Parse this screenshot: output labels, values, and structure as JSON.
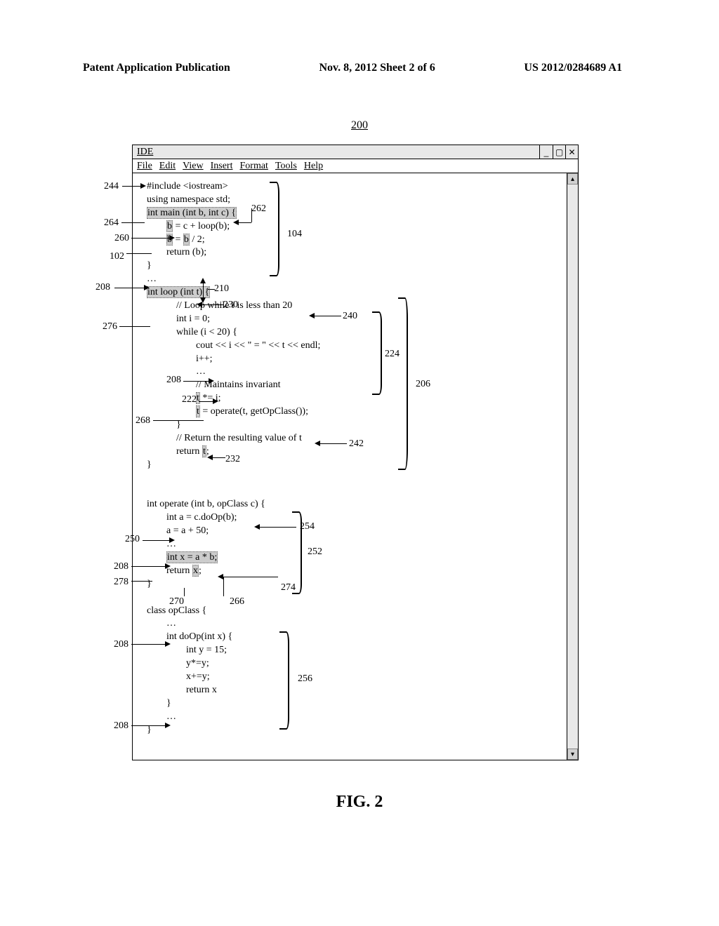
{
  "header": {
    "left": "Patent Application Publication",
    "center": "Nov. 8, 2012  Sheet 2 of 6",
    "right": "US 2012/0284689 A1"
  },
  "figure_number": "200",
  "window": {
    "title": "IDE",
    "menu": [
      "File",
      "Edit",
      "View",
      "Insert",
      "Format",
      "Tools",
      "Help"
    ]
  },
  "code": {
    "l1": "#include <iostream>",
    "l2": "using namespace std;",
    "blank1": "",
    "l3": "int main (int b, int c) {",
    "l4": "        b = c + loop(b);",
    "l5": "        b = b / 2;",
    "l6": "        return (b);",
    "l7": "}",
    "l8": "…",
    "l9": "int loop (int t) {",
    "l10": "            // Loop while i is less than 20",
    "l11": "            int i = 0;",
    "l12": "            while (i < 20) {",
    "l13": "                    cout << i << \" = \" << t << endl;",
    "l14": "                    i++;",
    "l15": "                    …",
    "l16": "                    // Maintains invariant",
    "l17": "                    t *= i;",
    "l18": "                    t = operate(t, getOpClass());",
    "l19": "            }",
    "l20": "            // Return the resulting value of t",
    "l21": "            return t;",
    "l22": "}",
    "blank3": "",
    "l23": "int operate (int b, opClass c) {",
    "l24": "        int a = c.doOp(b);",
    "l25": "        a = a + 50;",
    "l26": "        …",
    "l27": "        int x = a * b;",
    "l28": "        return x;",
    "l29": "}",
    "blank4": "",
    "l30": "class opClass {",
    "l31": "        …",
    "l32": "        int doOp(int x) {",
    "l33": "                int y = 15;",
    "l34": "                y*=y;",
    "l35": "                x+=y;",
    "l36": "                return x",
    "l37": "        }",
    "l38": "        …",
    "l39": "}"
  },
  "labels": {
    "r244": "244",
    "r264": "264",
    "r260": "260",
    "r102": "102",
    "r208a": "208",
    "r276": "276",
    "r210": "210",
    "r230": "230",
    "r240": "240",
    "r208b": "208",
    "r222": "222",
    "r268": "268",
    "r242": "242",
    "r232": "232",
    "r224": "224",
    "r206": "206",
    "r262": "262",
    "r104": "104",
    "r250": "250",
    "r254": "254",
    "r252": "252",
    "r208c": "208",
    "r278": "278",
    "r270": "270",
    "r266": "266",
    "r274": "274",
    "r208d": "208",
    "r208e": "208",
    "r256": "256"
  },
  "caption": "FIG. 2"
}
